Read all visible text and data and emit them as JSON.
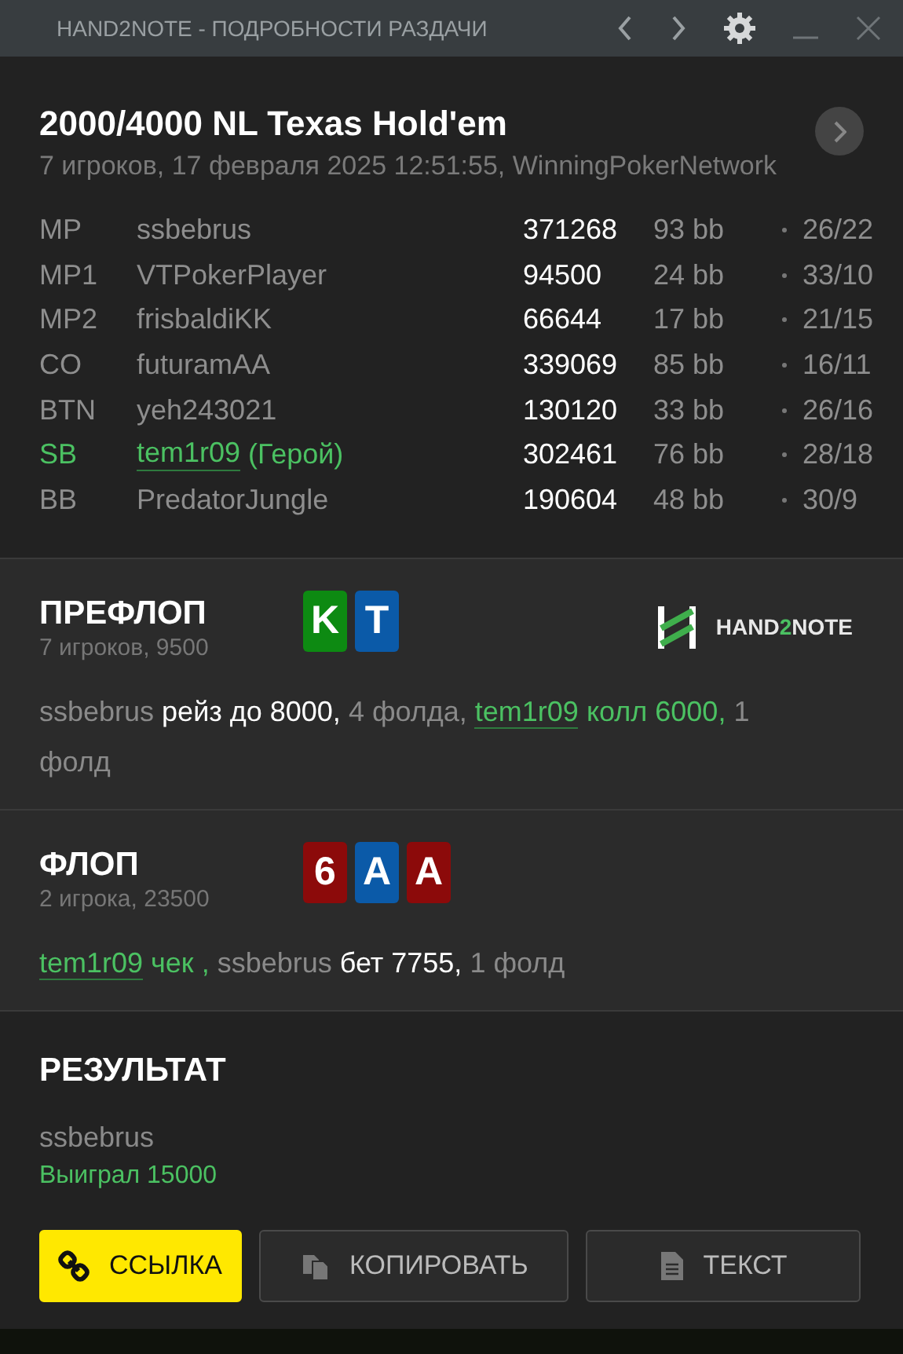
{
  "window": {
    "title": "HAND2NOTE - ПОДРОБНОСТИ РАЗДАЧИ"
  },
  "hand": {
    "title": "2000/4000 NL Texas Hold'em",
    "subtitle": "7 игроков, 17 февраля 2025 12:51:55, WinningPokerNetwork"
  },
  "players": [
    {
      "position": "MP",
      "name": "ssbebrus",
      "hero": false,
      "stack": "371268",
      "bb": "93 bb",
      "stats": "26/22"
    },
    {
      "position": "MP1",
      "name": "VTPokerPlayer",
      "hero": false,
      "stack": "94500",
      "bb": "24 bb",
      "stats": "33/10"
    },
    {
      "position": "MP2",
      "name": "frisbaldiKK",
      "hero": false,
      "stack": "66644",
      "bb": "17 bb",
      "stats": "21/15"
    },
    {
      "position": "CO",
      "name": "futuramAA",
      "hero": false,
      "stack": "339069",
      "bb": "85 bb",
      "stats": "16/11"
    },
    {
      "position": "BTN",
      "name": "yeh243021",
      "hero": false,
      "stack": "130120",
      "bb": "33 bb",
      "stats": "26/16"
    },
    {
      "position": "SB",
      "name": "tem1r09",
      "hero": true,
      "hero_label": "(Герой)",
      "stack": "302461",
      "bb": "76 bb",
      "stats": "28/18"
    },
    {
      "position": "BB",
      "name": "PredatorJungle",
      "hero": false,
      "stack": "190604",
      "bb": "48 bb",
      "stats": "30/9"
    }
  ],
  "streets": [
    {
      "name": "ПРЕФЛОП",
      "subtitle": "7 игроков, 9500",
      "cards": [
        {
          "rank": "K",
          "color": "#0d8a12"
        },
        {
          "rank": "T",
          "color": "#0b5aa8"
        }
      ],
      "logo": [
        {
          "text": "HAND",
          "accent": false
        },
        {
          "text": "2",
          "accent": true
        },
        {
          "text": "NOTE",
          "accent": false
        }
      ],
      "actions": [
        {
          "text": "ssbebrus",
          "kind": "muted"
        },
        {
          "text": " рейз до 8000,",
          "kind": "action"
        },
        {
          "text": " 4 фолда, ",
          "kind": "muted"
        },
        {
          "text": "tem1r09",
          "kind": "hero"
        },
        {
          "text": " колл 6000,",
          "kind": "hero-action"
        },
        {
          "text": " 1 фолд",
          "kind": "muted"
        }
      ]
    },
    {
      "name": "ФЛОП",
      "subtitle": "2 игрока, 23500",
      "cards": [
        {
          "rank": "6",
          "color": "#8c0a0a"
        },
        {
          "rank": "A",
          "color": "#0b5aa8"
        },
        {
          "rank": "A",
          "color": "#8c0a0a"
        }
      ],
      "actions": [
        {
          "text": "tem1r09",
          "kind": "hero"
        },
        {
          "text": " чек ,",
          "kind": "hero-action"
        },
        {
          "text": " ssbebrus",
          "kind": "muted"
        },
        {
          "text": " бет 7755,",
          "kind": "action"
        },
        {
          "text": " 1 фолд",
          "kind": "muted"
        }
      ]
    }
  ],
  "result": {
    "title": "РЕЗУЛЬТАТ",
    "player": "ssbebrus",
    "outcome": "Выиграл 15000"
  },
  "buttons": [
    {
      "label": "ССЫЛКА",
      "kind": "link",
      "primary": true
    },
    {
      "label": "КОПИРОВАТЬ",
      "kind": "copy",
      "primary": false
    },
    {
      "label": "ТЕКСТ",
      "kind": "text",
      "primary": false
    }
  ]
}
